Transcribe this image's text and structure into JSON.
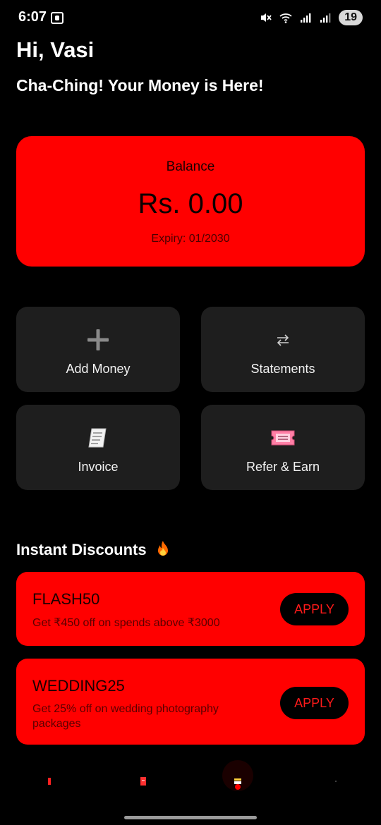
{
  "status": {
    "time": "6:07",
    "battery": "19"
  },
  "header": {
    "greeting": "Hi, Vasi",
    "tagline": "Cha-Ching! Your Money is Here!"
  },
  "balance": {
    "label": "Balance",
    "amount": "Rs. 0.00",
    "expiry": "Expiry: 01/2030"
  },
  "actions": [
    {
      "label": "Add Money",
      "icon": "plus-icon"
    },
    {
      "label": "Statements",
      "icon": "swap-arrows-icon"
    },
    {
      "label": "Invoice",
      "icon": "receipt-icon"
    },
    {
      "label": "Refer & Earn",
      "icon": "ticket-icon"
    }
  ],
  "discounts": {
    "title": "Instant Discounts",
    "items": [
      {
        "code": "FLASH50",
        "description": "Get ₹450 off on spends above ₹3000",
        "button": "APPLY"
      },
      {
        "code": "WEDDING25",
        "description": "Get 25% off on wedding photography packages",
        "button": "APPLY"
      }
    ]
  },
  "nav": {
    "icons": [
      "home-icon",
      "document-icon",
      "wallet-icon",
      "profile-icon"
    ]
  },
  "colors": {
    "accent": "#ff0000",
    "background": "#000000",
    "tile": "#1e1e1e"
  }
}
